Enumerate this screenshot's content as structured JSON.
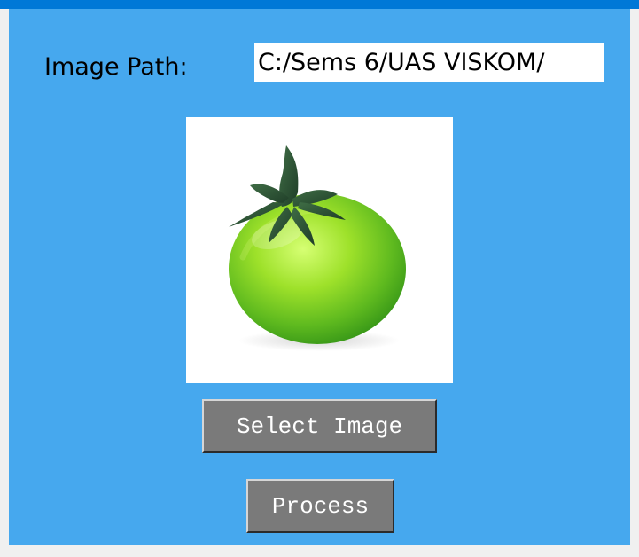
{
  "window": {
    "accent_color": "#0078d7",
    "panel_color": "#46a8ee"
  },
  "form": {
    "path_label": "Image Path:",
    "path_value": "C:/Sems 6/UAS VISKOM/"
  },
  "preview": {
    "image_subject": "green tomato"
  },
  "buttons": {
    "select_label": "Select Image",
    "process_label": "Process"
  }
}
